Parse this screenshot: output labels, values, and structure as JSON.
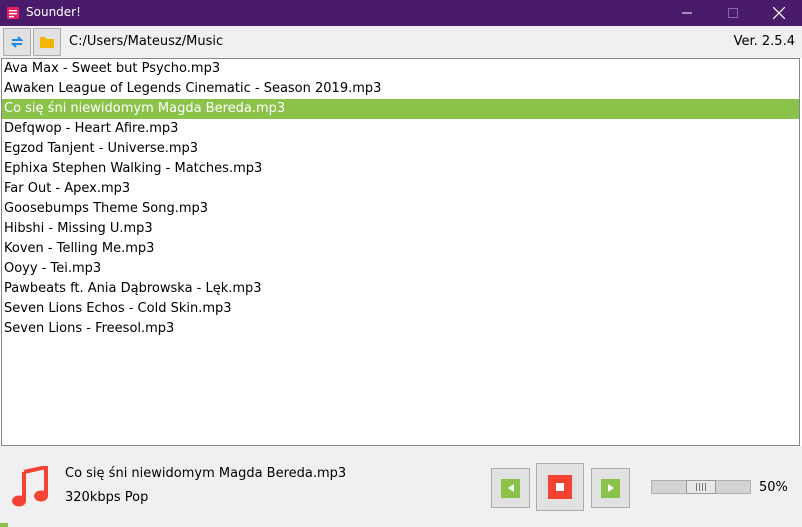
{
  "window": {
    "title": "Sounder!"
  },
  "toolbar": {
    "path": "C:/Users/Mateusz/Music",
    "version": "Ver. 2.5.4"
  },
  "songs": [
    "Ava Max - Sweet but Psycho.mp3",
    "Awaken  League of Legends Cinematic - Season 2019.mp3",
    "Co się śni niewidomym Magda Bereda.mp3",
    "Defqwop - Heart Afire.mp3",
    "Egzod  Tanjent - Universe.mp3",
    "Ephixa  Stephen Walking - Matches.mp3",
    "Far Out - Apex.mp3",
    "Goosebumps Theme Song.mp3",
    "Hibshi - Missing U.mp3",
    "Koven - Telling Me.mp3",
    "Ooyy - Tei.mp3",
    "Pawbeats ft. Ania Dąbrowska - Lęk.mp3",
    "Seven Lions  Echos - Cold Skin.mp3",
    "Seven Lions - Freesol.mp3"
  ],
  "selected_index": 2,
  "player": {
    "now_playing": "Co się śni niewidomym Magda Bereda.mp3",
    "meta": "320kbps Pop",
    "volume_label": "50%",
    "volume": 0.5,
    "playback_progress": 0.01
  },
  "colors": {
    "titlebar": "#4b1b6b",
    "accent_green": "#8bc34a",
    "stop_red": "#f44336",
    "folder_yellow": "#f5b400",
    "refresh_blue": "#1e88e5"
  },
  "icons": {
    "app": "app-icon",
    "refresh": "refresh-icon",
    "folder": "folder-icon",
    "note": "music-note-icon",
    "prev": "previous-icon",
    "stop": "stop-icon",
    "next": "next-icon"
  }
}
